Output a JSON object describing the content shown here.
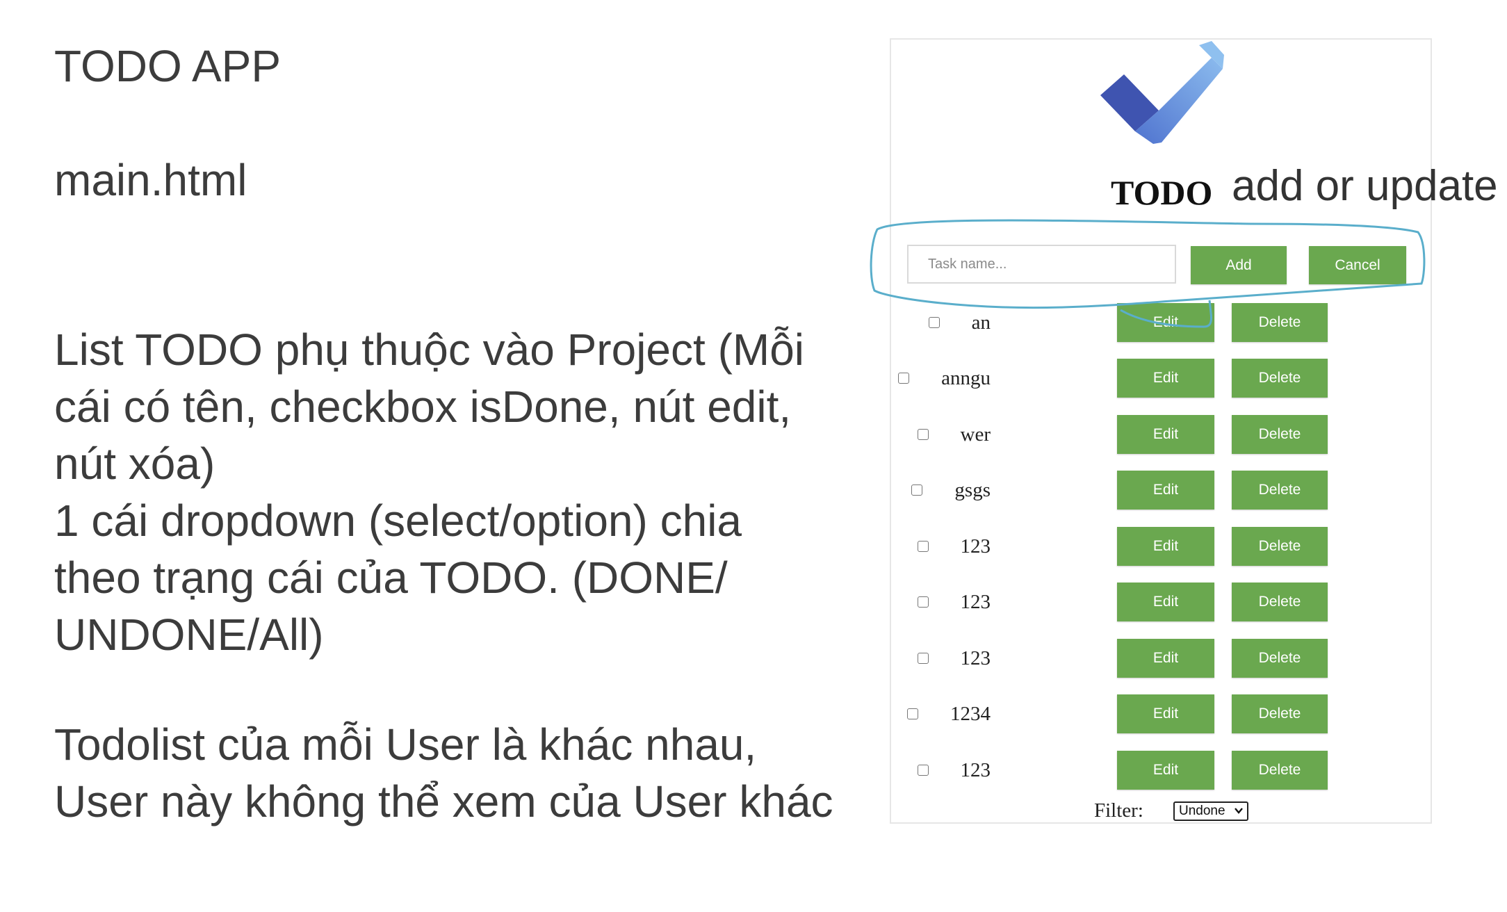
{
  "notes": {
    "title": "TODO APP",
    "file": "main.html",
    "block1": [
      "List TODO phụ thuộc vào Project (Mỗi",
      "cái có tên, checkbox isDone, nút edit,",
      "nút xóa)",
      "1 cái dropdown (select/option) chia",
      "theo trạng cái của TODO. (DONE/",
      "UNDONE/All)"
    ],
    "block2": [
      "Todolist của mỗi User là khác nhau,",
      "User này không thể xem của User khác"
    ]
  },
  "app": {
    "title": "TODO",
    "annotation": "add or update",
    "input_placeholder": "Task name...",
    "add_label": "Add",
    "cancel_label": "Cancel",
    "edit_label": "Edit",
    "delete_label": "Delete",
    "todos": [
      {
        "name": "an",
        "done": false
      },
      {
        "name": "anngu",
        "done": false
      },
      {
        "name": "wer",
        "done": false
      },
      {
        "name": "gsgs",
        "done": false
      },
      {
        "name": "123",
        "done": false
      },
      {
        "name": "123",
        "done": false
      },
      {
        "name": "123",
        "done": false
      },
      {
        "name": "1234",
        "done": false
      },
      {
        "name": "123",
        "done": false
      }
    ],
    "filter_label": "Filter:",
    "filter_value": "Undone"
  },
  "colors": {
    "button_green": "#6aa84f",
    "annotation_stroke": "#5aaecb",
    "logo_dark": "#3f5db8",
    "logo_light": "#7fb0e8"
  },
  "icons": {
    "logo": "checkmark-logo-icon",
    "select_caret": "chevron-down-icon"
  }
}
